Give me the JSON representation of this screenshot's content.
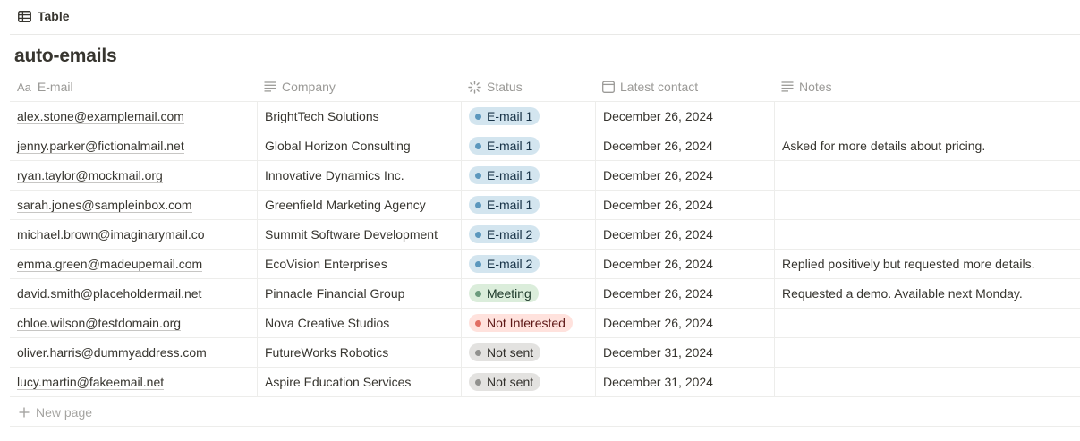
{
  "view": {
    "tab_label": "Table",
    "tab_icon": "table-icon"
  },
  "database": {
    "title": "auto-emails"
  },
  "columns": [
    {
      "label": "E-mail",
      "icon": "Aa",
      "icon_name": "title-property-icon"
    },
    {
      "label": "Company",
      "icon_name": "text-property-icon"
    },
    {
      "label": "Status",
      "icon_name": "status-property-icon"
    },
    {
      "label": "Latest contact",
      "icon_name": "calendar-icon"
    },
    {
      "label": "Notes",
      "icon_name": "text-property-icon"
    }
  ],
  "status_colors": {
    "E-mail 1": {
      "bg": "#d3e5ef",
      "dot": "#5b97bd",
      "text": "#183347"
    },
    "E-mail 2": {
      "bg": "#d3e5ef",
      "dot": "#5b97bd",
      "text": "#183347"
    },
    "Meeting": {
      "bg": "#dbeddb",
      "dot": "#6c9b7d",
      "text": "#1c3829"
    },
    "Not Interested": {
      "bg": "#ffe2dd",
      "dot": "#e16f64",
      "text": "#5d1715"
    },
    "Not sent": {
      "bg": "#e3e2e0",
      "dot": "#91918e",
      "text": "#32302c"
    }
  },
  "rows": [
    {
      "email": "alex.stone@examplemail.com",
      "company": "BrightTech Solutions",
      "status": "E-mail 1",
      "latest_contact": "December 26, 2024",
      "notes": ""
    },
    {
      "email": "jenny.parker@fictionalmail.net",
      "company": "Global Horizon Consulting",
      "status": "E-mail 1",
      "latest_contact": "December 26, 2024",
      "notes": "Asked for more details about pricing."
    },
    {
      "email": "ryan.taylor@mockmail.org",
      "company": "Innovative Dynamics Inc.",
      "status": "E-mail 1",
      "latest_contact": "December 26, 2024",
      "notes": ""
    },
    {
      "email": "sarah.jones@sampleinbox.com",
      "company": "Greenfield Marketing Agency",
      "status": "E-mail 1",
      "latest_contact": "December 26, 2024",
      "notes": ""
    },
    {
      "email": "michael.brown@imaginarymail.co",
      "company": "Summit Software Development",
      "status": "E-mail 2",
      "latest_contact": "December 26, 2024",
      "notes": ""
    },
    {
      "email": "emma.green@madeupemail.com",
      "company": "EcoVision Enterprises",
      "status": "E-mail 2",
      "latest_contact": "December 26, 2024",
      "notes": "Replied positively but requested more details."
    },
    {
      "email": "david.smith@placeholdermail.net",
      "company": "Pinnacle Financial Group",
      "status": "Meeting",
      "latest_contact": "December 26, 2024",
      "notes": "Requested a demo. Available next Monday."
    },
    {
      "email": "chloe.wilson@testdomain.org",
      "company": "Nova Creative Studios",
      "status": "Not Interested",
      "latest_contact": "December 26, 2024",
      "notes": ""
    },
    {
      "email": "oliver.harris@dummyaddress.com",
      "company": "FutureWorks Robotics",
      "status": "Not sent",
      "latest_contact": "December 31, 2024",
      "notes": ""
    },
    {
      "email": "lucy.martin@fakeemail.net",
      "company": "Aspire Education Services",
      "status": "Not sent",
      "latest_contact": "December 31, 2024",
      "notes": ""
    }
  ],
  "footer": {
    "new_page_label": "New page"
  }
}
